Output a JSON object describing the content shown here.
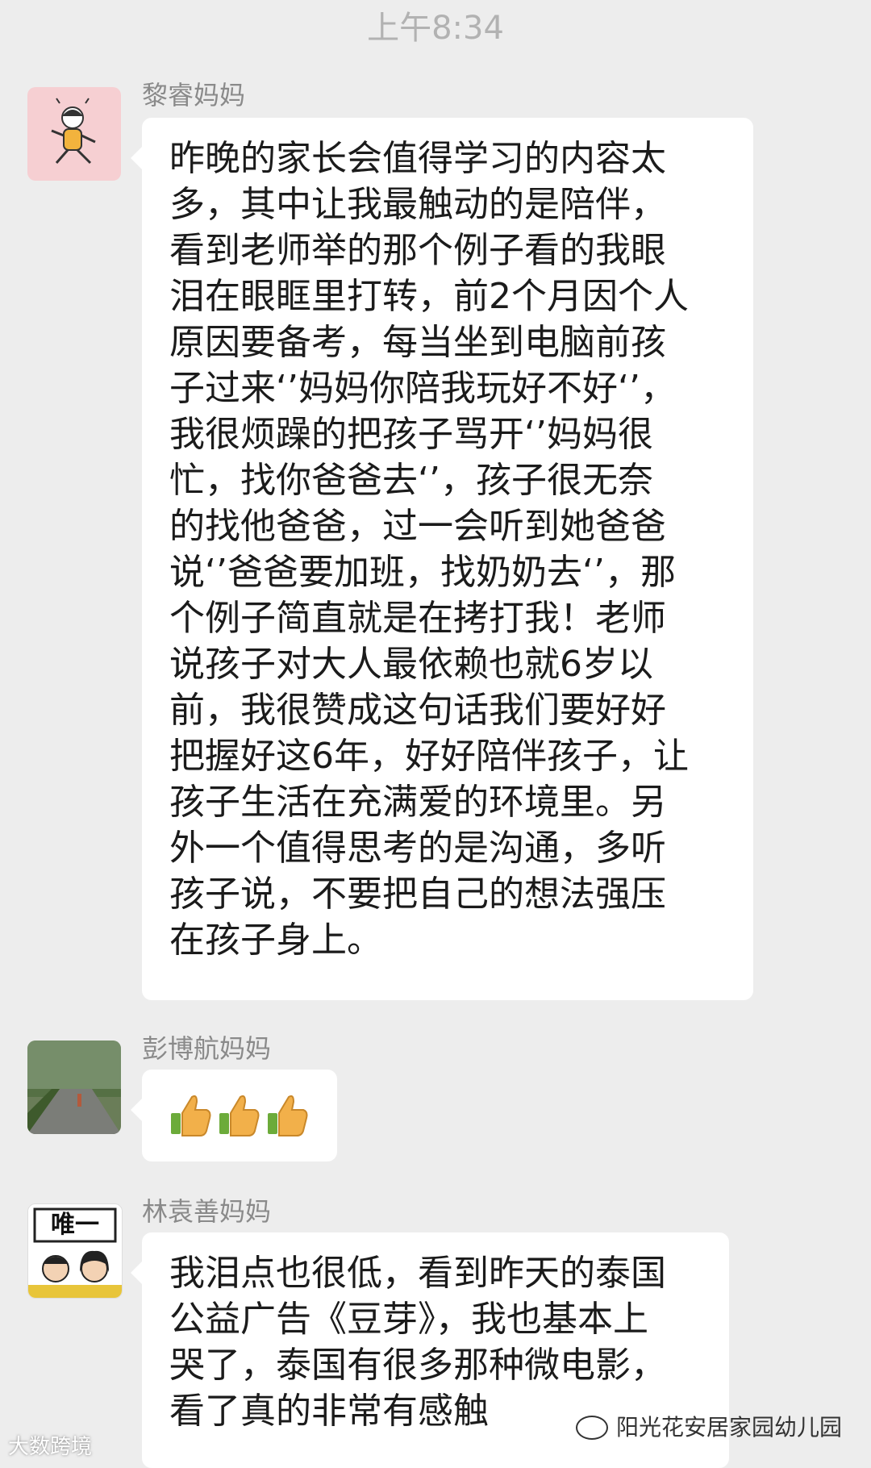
{
  "chat": {
    "timestamp": "上午8:34",
    "messages": [
      {
        "sender": "黎睿妈妈",
        "text": "昨晚的家长会值得学习的内容太\n多，其中让我最触动的是陪伴，\n看到老师举的那个例子看的我眼\n泪在眼眶里打转，前2个月因个人\n原因要备考，每当坐到电脑前孩\n子过来‘’妈妈你陪我玩好不好‘’，\n我很烦躁的把孩子骂开‘’妈妈很\n忙，找你爸爸去‘’，孩子很无奈\n的找他爸爸，过一会听到她爸爸\n说‘’爸爸要加班，找奶奶去‘’，那\n个例子简直就是在拷打我！老师\n说孩子对大人最依赖也就6岁以\n前，我很赞成这句话我们要好好\n把握好这6年，好好陪伴孩子，让\n孩子生活在充满爱的环境里。另\n外一个值得思考的是沟通，多听\n孩子说，不要把自己的想法强压\n在孩子身上。"
      },
      {
        "sender": "彭博航妈妈",
        "emoji": [
          "thumbs-up-icon",
          "thumbs-up-icon",
          "thumbs-up-icon"
        ]
      },
      {
        "sender": "林袁善妈妈",
        "text": "我泪点也很低，看到昨天的泰国\n公益广告《豆芽》，我也基本上\n哭了，泰国有很多那种微电影，\n看了真的非常有感触",
        "avatar_label": "唯一"
      }
    ]
  },
  "watermark": {
    "left": "大数跨境",
    "right": "阳光花安居家园幼儿园"
  },
  "colors": {
    "background": "#ededed",
    "bubble": "#ffffff",
    "thumb": "#f2b04a"
  }
}
